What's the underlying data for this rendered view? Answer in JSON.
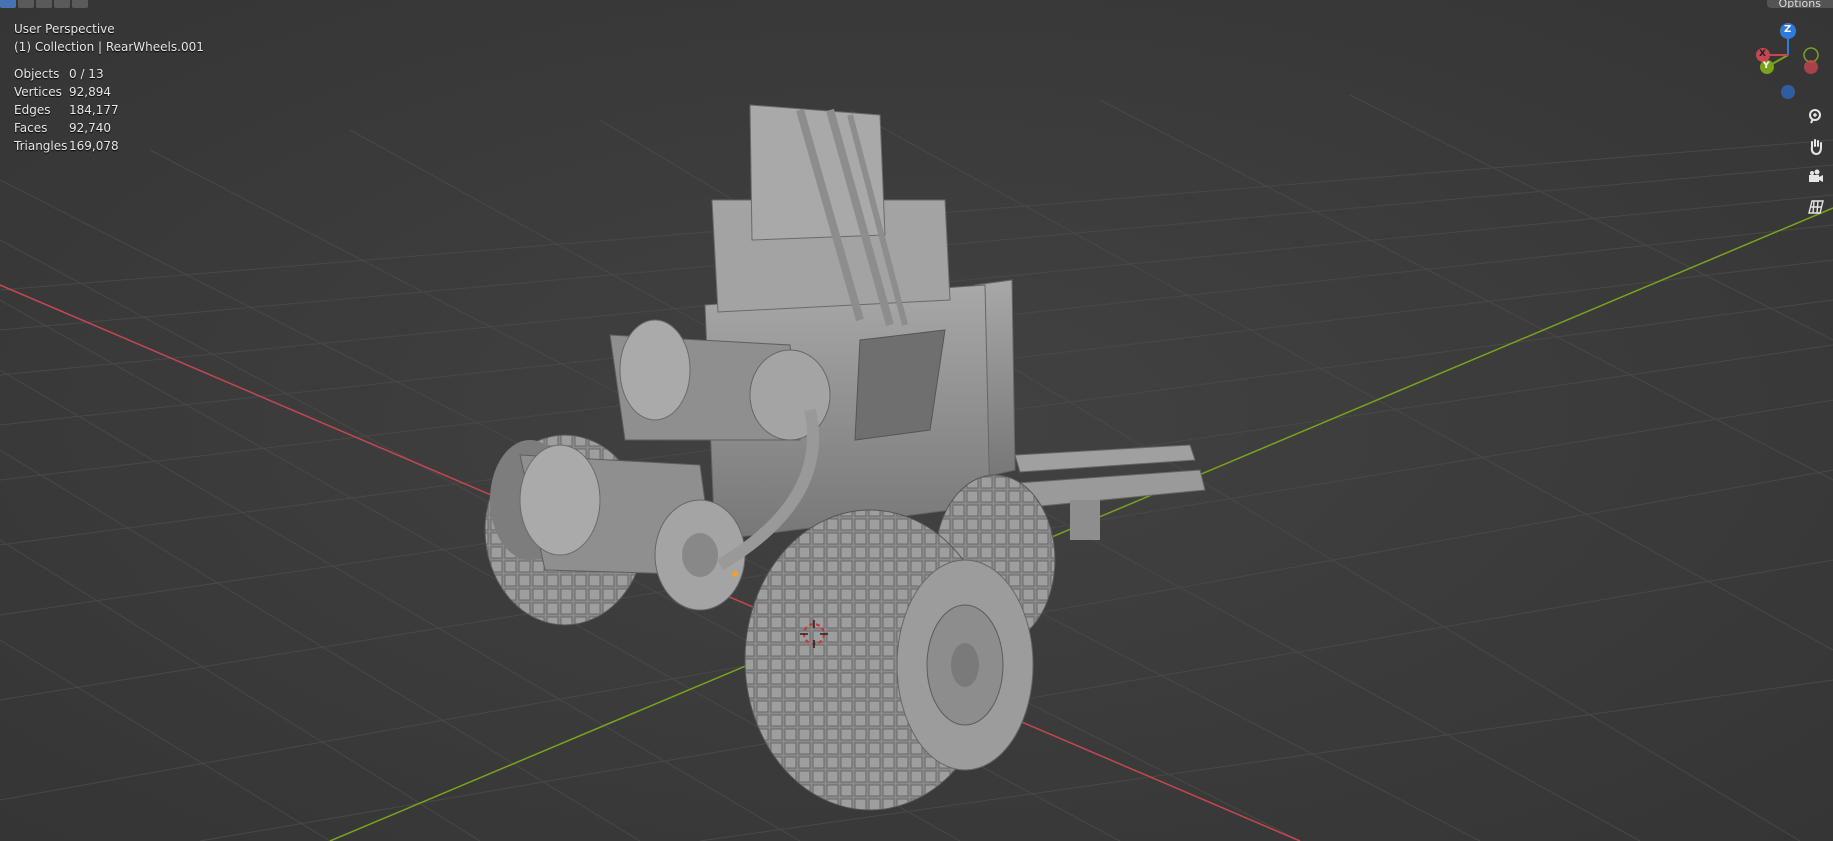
{
  "viewport": {
    "view_name": "User Perspective",
    "collection_line": "(1) Collection | RearWheels.001"
  },
  "stats": [
    {
      "label": "Objects",
      "value": "0 / 13"
    },
    {
      "label": "Vertices",
      "value": "92,894"
    },
    {
      "label": "Edges",
      "value": "184,177"
    },
    {
      "label": "Faces",
      "value": "92,740"
    },
    {
      "label": "Triangles",
      "value": "169,078"
    }
  ],
  "header": {
    "options_label": "Options"
  },
  "gizmo": {
    "z_label": "Z",
    "y_label": "Y",
    "x_label": "X"
  },
  "nav_tools": [
    "zoom-icon",
    "hand-pan-icon",
    "camera-icon",
    "grid-ortho-icon"
  ],
  "colors": {
    "background": "#3d3d3d",
    "grid": "#4a4a4a",
    "x_axis": "#c6464f",
    "y_axis": "#7aa21e",
    "z_axis": "#2f7bd9",
    "model": "#9a9a9a"
  }
}
